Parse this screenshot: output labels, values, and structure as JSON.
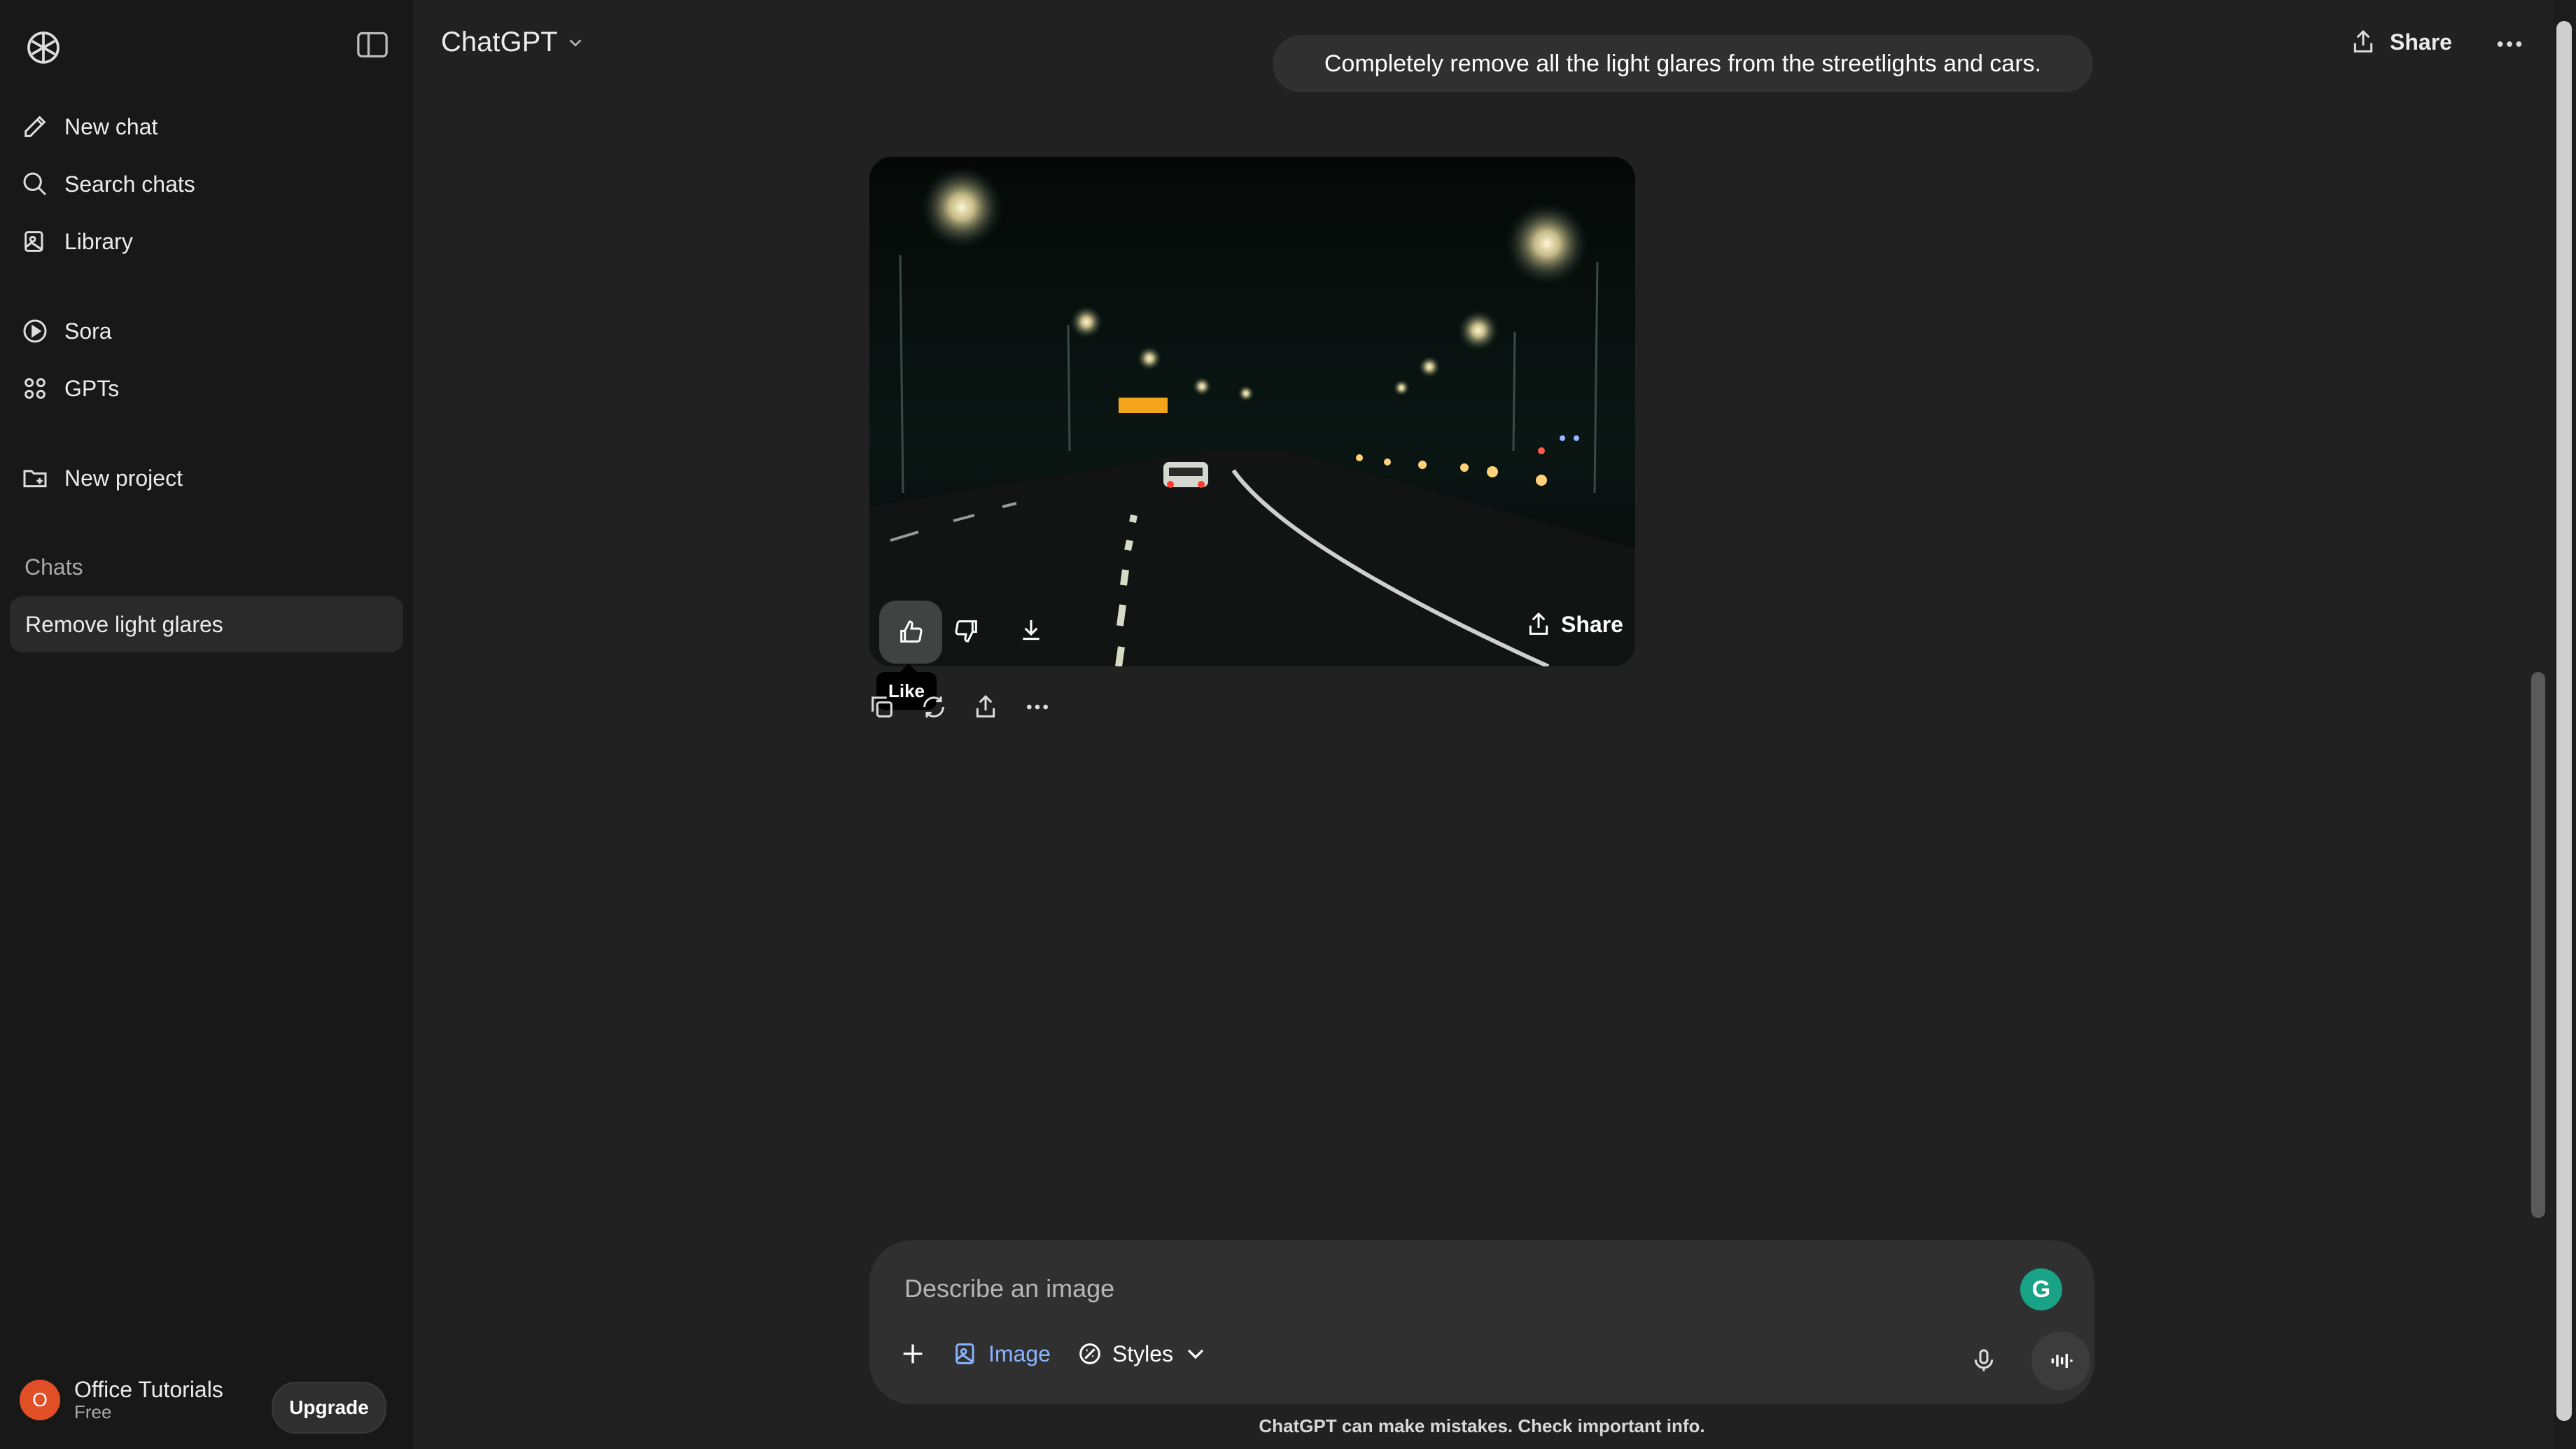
{
  "sidebar": {
    "items": [
      {
        "label": "New chat"
      },
      {
        "label": "Search chats"
      },
      {
        "label": "Library"
      },
      {
        "label": "Sora"
      },
      {
        "label": "GPTs"
      },
      {
        "label": "New project"
      }
    ],
    "section_label": "Chats",
    "chats": [
      {
        "label": "Remove light glares"
      }
    ],
    "user": {
      "initial": "O",
      "name": "Office Tutorials",
      "plan": "Free"
    },
    "upgrade_label": "Upgrade"
  },
  "header": {
    "model": "ChatGPT",
    "share_label": "Share"
  },
  "conversation": {
    "user_message": "Completely remove all the light glares from the streetlights and cars.",
    "image_share_label": "Share",
    "tooltip": "Like"
  },
  "composer": {
    "placeholder": "Describe an image",
    "image_label": "Image",
    "styles_label": "Styles",
    "disclaimer": "ChatGPT can make mistakes. Check important info."
  },
  "colors": {
    "background": "#212121",
    "sidebar": "#181818",
    "accent": "#8ab4ff",
    "avatar": "#e14f27"
  },
  "icons": [
    "openai-logo-icon",
    "sidebar-toggle-icon",
    "new-chat-icon",
    "search-icon",
    "library-icon",
    "sora-play-icon",
    "gpts-grid-icon",
    "new-project-icon",
    "chevron-down-icon",
    "share-icon",
    "more-icon",
    "thumbs-up-icon",
    "thumbs-down-icon",
    "download-icon",
    "copy-icon",
    "regenerate-icon",
    "plus-icon",
    "image-icon",
    "styles-icon",
    "microphone-icon",
    "voice-waveform-icon",
    "grammarly-icon"
  ]
}
